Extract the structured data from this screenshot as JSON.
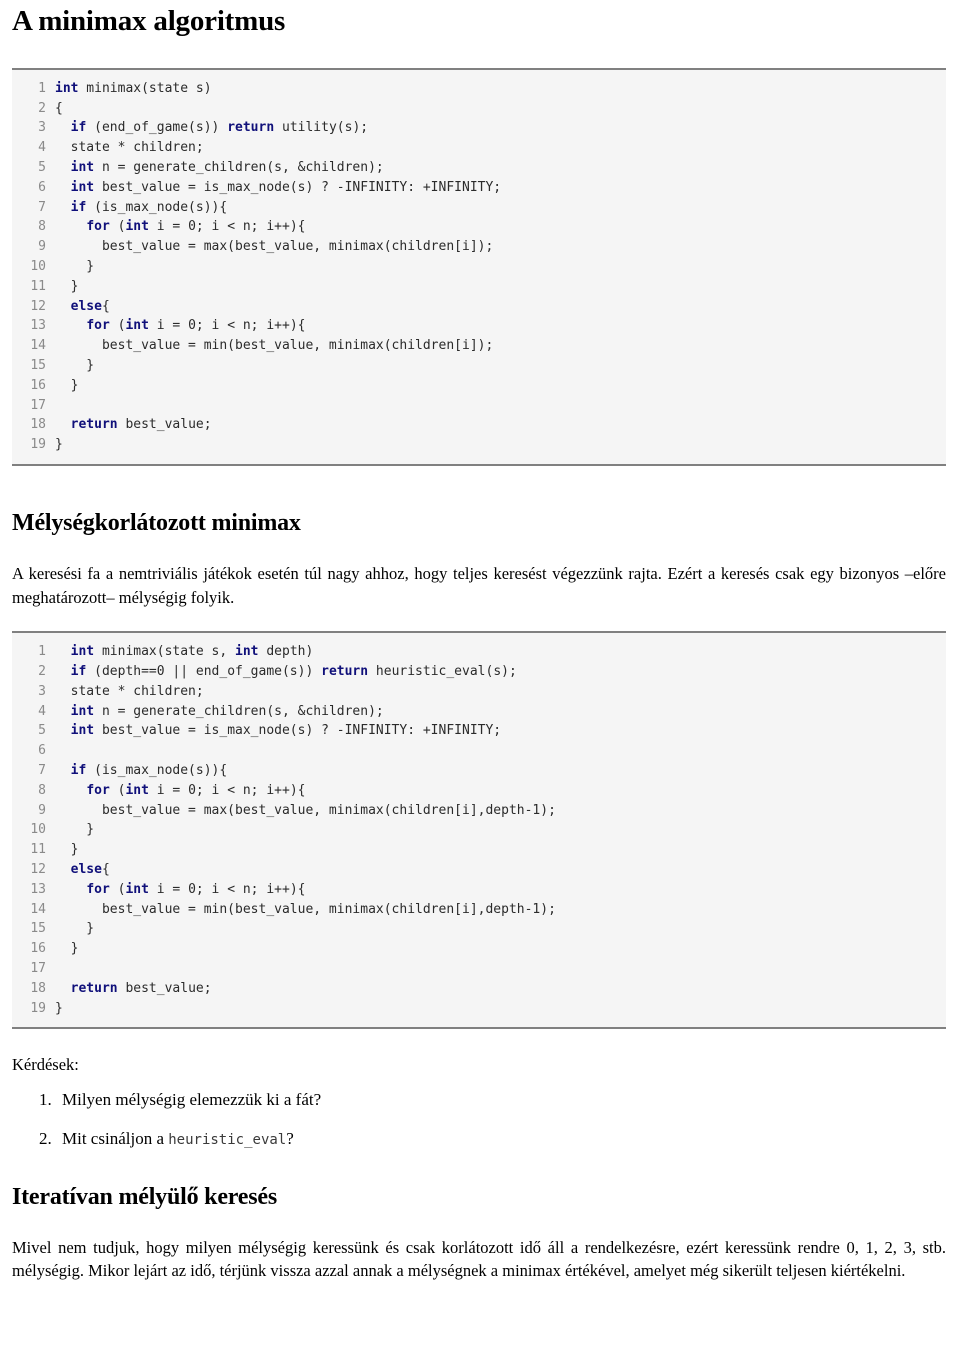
{
  "document": {
    "title": "A minimax algoritmus"
  },
  "code_block_1": {
    "name": "minimax-code",
    "lines": [
      {
        "n": "1",
        "parts": [
          {
            "t": "kw",
            "s": "int"
          },
          {
            "t": "plain",
            "s": " minimax(state s)"
          }
        ]
      },
      {
        "n": "2",
        "parts": [
          {
            "t": "plain",
            "s": "{"
          }
        ]
      },
      {
        "n": "3",
        "parts": [
          {
            "t": "plain",
            "s": "  "
          },
          {
            "t": "kw",
            "s": "if"
          },
          {
            "t": "plain",
            "s": " (end_of_game(s)) "
          },
          {
            "t": "kw",
            "s": "return"
          },
          {
            "t": "plain",
            "s": " utility(s);"
          }
        ]
      },
      {
        "n": "4",
        "parts": [
          {
            "t": "plain",
            "s": "  state * children;"
          }
        ]
      },
      {
        "n": "5",
        "parts": [
          {
            "t": "plain",
            "s": "  "
          },
          {
            "t": "kw",
            "s": "int"
          },
          {
            "t": "plain",
            "s": " n = generate_children(s, &children);"
          }
        ]
      },
      {
        "n": "6",
        "parts": [
          {
            "t": "plain",
            "s": "  "
          },
          {
            "t": "kw",
            "s": "int"
          },
          {
            "t": "plain",
            "s": " best_value = is_max_node(s) ? -INFINITY: +INFINITY;"
          }
        ]
      },
      {
        "n": "7",
        "parts": [
          {
            "t": "plain",
            "s": "  "
          },
          {
            "t": "kw",
            "s": "if"
          },
          {
            "t": "plain",
            "s": " (is_max_node(s)){"
          }
        ]
      },
      {
        "n": "8",
        "parts": [
          {
            "t": "plain",
            "s": "    "
          },
          {
            "t": "kw",
            "s": "for"
          },
          {
            "t": "plain",
            "s": " ("
          },
          {
            "t": "kw",
            "s": "int"
          },
          {
            "t": "plain",
            "s": " i = 0; i < n; i++){"
          }
        ]
      },
      {
        "n": "9",
        "parts": [
          {
            "t": "plain",
            "s": "      best_value = max(best_value, minimax(children[i]);"
          }
        ]
      },
      {
        "n": "10",
        "parts": [
          {
            "t": "plain",
            "s": "    }"
          }
        ]
      },
      {
        "n": "11",
        "parts": [
          {
            "t": "plain",
            "s": "  }"
          }
        ]
      },
      {
        "n": "12",
        "parts": [
          {
            "t": "plain",
            "s": "  "
          },
          {
            "t": "kw",
            "s": "else"
          },
          {
            "t": "plain",
            "s": "{"
          }
        ]
      },
      {
        "n": "13",
        "parts": [
          {
            "t": "plain",
            "s": "    "
          },
          {
            "t": "kw",
            "s": "for"
          },
          {
            "t": "plain",
            "s": " ("
          },
          {
            "t": "kw",
            "s": "int"
          },
          {
            "t": "plain",
            "s": " i = 0; i < n; i++){"
          }
        ]
      },
      {
        "n": "14",
        "parts": [
          {
            "t": "plain",
            "s": "      best_value = min(best_value, minimax(children[i]);"
          }
        ]
      },
      {
        "n": "15",
        "parts": [
          {
            "t": "plain",
            "s": "    }"
          }
        ]
      },
      {
        "n": "16",
        "parts": [
          {
            "t": "plain",
            "s": "  }"
          }
        ]
      },
      {
        "n": "17",
        "parts": [
          {
            "t": "plain",
            "s": ""
          }
        ]
      },
      {
        "n": "18",
        "parts": [
          {
            "t": "plain",
            "s": "  "
          },
          {
            "t": "kw",
            "s": "return"
          },
          {
            "t": "plain",
            "s": " best_value;"
          }
        ]
      },
      {
        "n": "19",
        "parts": [
          {
            "t": "plain",
            "s": "}"
          }
        ]
      }
    ]
  },
  "section_depth_limited": {
    "heading": "Mélységkorlátozott minimax",
    "paragraph": "A keresési fa a nemtriviális játékok esetén túl nagy ahhoz, hogy teljes keresést végezzünk rajta. Ezért a keresés csak egy bizonyos –előre meghatározott– mélységig folyik."
  },
  "code_block_2": {
    "name": "depth-limited-minimax-code",
    "lines": [
      {
        "n": "1",
        "parts": [
          {
            "t": "plain",
            "s": "  "
          },
          {
            "t": "kw",
            "s": "int"
          },
          {
            "t": "plain",
            "s": " minimax(state s, "
          },
          {
            "t": "kw",
            "s": "int"
          },
          {
            "t": "plain",
            "s": " depth)"
          }
        ]
      },
      {
        "n": "2",
        "parts": [
          {
            "t": "plain",
            "s": "  "
          },
          {
            "t": "kw",
            "s": "if"
          },
          {
            "t": "plain",
            "s": " (depth==0 || end_of_game(s)) "
          },
          {
            "t": "kw",
            "s": "return"
          },
          {
            "t": "plain",
            "s": " heuristic_eval(s);"
          }
        ]
      },
      {
        "n": "3",
        "parts": [
          {
            "t": "plain",
            "s": "  state * children;"
          }
        ]
      },
      {
        "n": "4",
        "parts": [
          {
            "t": "plain",
            "s": "  "
          },
          {
            "t": "kw",
            "s": "int"
          },
          {
            "t": "plain",
            "s": " n = generate_children(s, &children);"
          }
        ]
      },
      {
        "n": "5",
        "parts": [
          {
            "t": "plain",
            "s": "  "
          },
          {
            "t": "kw",
            "s": "int"
          },
          {
            "t": "plain",
            "s": " best_value = is_max_node(s) ? -INFINITY: +INFINITY;"
          }
        ]
      },
      {
        "n": "6",
        "parts": [
          {
            "t": "plain",
            "s": ""
          }
        ]
      },
      {
        "n": "7",
        "parts": [
          {
            "t": "plain",
            "s": "  "
          },
          {
            "t": "kw",
            "s": "if"
          },
          {
            "t": "plain",
            "s": " (is_max_node(s)){"
          }
        ]
      },
      {
        "n": "8",
        "parts": [
          {
            "t": "plain",
            "s": "    "
          },
          {
            "t": "kw",
            "s": "for"
          },
          {
            "t": "plain",
            "s": " ("
          },
          {
            "t": "kw",
            "s": "int"
          },
          {
            "t": "plain",
            "s": " i = 0; i < n; i++){"
          }
        ]
      },
      {
        "n": "9",
        "parts": [
          {
            "t": "plain",
            "s": "      best_value = max(best_value, minimax(children[i],depth-1);"
          }
        ]
      },
      {
        "n": "10",
        "parts": [
          {
            "t": "plain",
            "s": "    }"
          }
        ]
      },
      {
        "n": "11",
        "parts": [
          {
            "t": "plain",
            "s": "  }"
          }
        ]
      },
      {
        "n": "12",
        "parts": [
          {
            "t": "plain",
            "s": "  "
          },
          {
            "t": "kw",
            "s": "else"
          },
          {
            "t": "plain",
            "s": "{"
          }
        ]
      },
      {
        "n": "13",
        "parts": [
          {
            "t": "plain",
            "s": "    "
          },
          {
            "t": "kw",
            "s": "for"
          },
          {
            "t": "plain",
            "s": " ("
          },
          {
            "t": "kw",
            "s": "int"
          },
          {
            "t": "plain",
            "s": " i = 0; i < n; i++){"
          }
        ]
      },
      {
        "n": "14",
        "parts": [
          {
            "t": "plain",
            "s": "      best_value = min(best_value, minimax(children[i],depth-1);"
          }
        ]
      },
      {
        "n": "15",
        "parts": [
          {
            "t": "plain",
            "s": "    }"
          }
        ]
      },
      {
        "n": "16",
        "parts": [
          {
            "t": "plain",
            "s": "  }"
          }
        ]
      },
      {
        "n": "17",
        "parts": [
          {
            "t": "plain",
            "s": ""
          }
        ]
      },
      {
        "n": "18",
        "parts": [
          {
            "t": "plain",
            "s": "  "
          },
          {
            "t": "kw",
            "s": "return"
          },
          {
            "t": "plain",
            "s": " best_value;"
          }
        ]
      },
      {
        "n": "19",
        "parts": [
          {
            "t": "plain",
            "s": "}"
          }
        ]
      }
    ]
  },
  "questions": {
    "label": "Kérdések:",
    "items": [
      {
        "text_before": "Milyen mélységig elemezzük ki a fát?",
        "code": "",
        "text_after": ""
      },
      {
        "text_before": "Mit csináljon a ",
        "code": "heuristic_eval",
        "text_after": "?"
      }
    ]
  },
  "section_iterative_deepening": {
    "heading": "Iteratívan mélyülő keresés",
    "paragraph": "Mivel nem tudjuk, hogy milyen mélységig keressünk és csak korlátozott idő áll a rendelkezésre, ezért keressünk rendre 0, 1, 2, 3, stb. mélységig. Mikor lejárt az idő, térjünk vissza azzal annak a mélységnek a minimax értékével, amelyet még sikerült teljesen kiértékelni."
  },
  "colors": {
    "keyword": "#10107a",
    "code_bg": "#f5f5f5",
    "code_border": "#808080",
    "line_number": "#8a8a8a",
    "code_text": "#2b2b2b",
    "body_text": "#000000"
  }
}
